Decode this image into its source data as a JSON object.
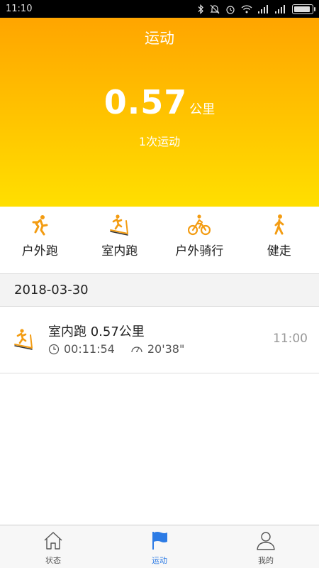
{
  "status_bar": {
    "time": "11:10",
    "icons": [
      "bluetooth-icon",
      "alarm-off-icon",
      "alarm-icon",
      "wifi-icon",
      "signal-icon",
      "signal-icon",
      "battery-icon"
    ],
    "battery_level": 0.9
  },
  "header": {
    "title": "运动",
    "distance_value": "0.57",
    "distance_unit": "公里",
    "count_text": "1次运动",
    "gradient_colors": [
      "#ffa500",
      "#ffdf00"
    ]
  },
  "sport_types": [
    {
      "label": "户外跑",
      "icon": "outdoor-run-icon"
    },
    {
      "label": "室内跑",
      "icon": "treadmill-icon"
    },
    {
      "label": "户外骑行",
      "icon": "cycling-icon"
    },
    {
      "label": "健走",
      "icon": "walking-icon"
    }
  ],
  "accent_color": "#f39c12",
  "records_section": {
    "date": "2018-03-30",
    "records": [
      {
        "title": "室内跑 0.57公里",
        "duration": "00:11:54",
        "pace": "20'38\"",
        "time": "11:00",
        "icon": "treadmill-icon"
      }
    ]
  },
  "bottom_nav": [
    {
      "label": "状态",
      "icon": "home-icon",
      "active": false
    },
    {
      "label": "运动",
      "icon": "flag-icon",
      "active": true
    },
    {
      "label": "我的",
      "icon": "person-icon",
      "active": false
    }
  ]
}
